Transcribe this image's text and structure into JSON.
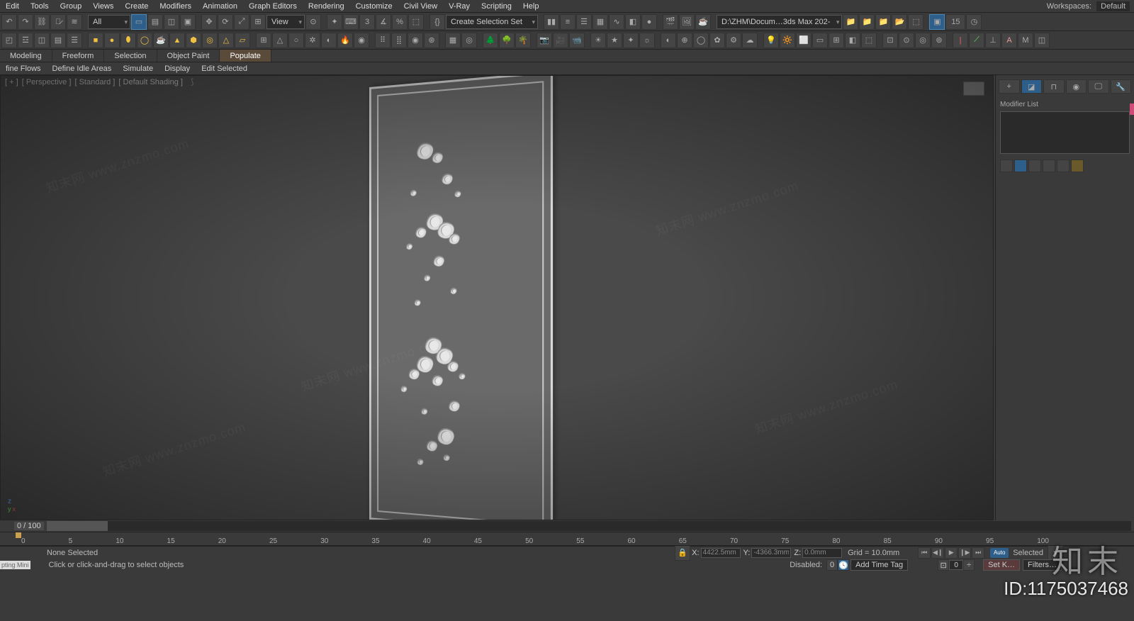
{
  "menu": {
    "items": [
      "Edit",
      "Tools",
      "Group",
      "Views",
      "Create",
      "Modifiers",
      "Animation",
      "Graph Editors",
      "Rendering",
      "Customize",
      "Civil View",
      "V-Ray",
      "Scripting",
      "Help"
    ],
    "workspaces_label": "Workspaces:",
    "workspaces_value": "Default"
  },
  "toolbar1": {
    "filter_dd": "All",
    "view_dd": "View",
    "selset_dd": "Create Selection Set",
    "path": "D:\\ZHM\\Docum…3ds Max 202-",
    "badge": "15"
  },
  "ribbon": {
    "tabs": [
      "Modeling",
      "Freeform",
      "Selection",
      "Object Paint",
      "Populate"
    ],
    "active": 4
  },
  "subribbon": {
    "items": [
      "fine Flows",
      "Define Idle Areas",
      "Simulate",
      "Display",
      "Edit Selected"
    ]
  },
  "viewport": {
    "labels": [
      "[ + ]",
      "[ Perspective ]",
      "[ Standard ]",
      "[ Default Shading ]"
    ],
    "filter_glyph": "⟆"
  },
  "cmdpanel": {
    "modifier_label": "Modifier List"
  },
  "timeline": {
    "frame_label": "0 / 100",
    "ticks": [
      "0",
      "5",
      "10",
      "15",
      "20",
      "25",
      "30",
      "35",
      "40",
      "45",
      "50",
      "55",
      "60",
      "65",
      "70",
      "75",
      "80",
      "85",
      "90",
      "95",
      "100"
    ]
  },
  "status": {
    "none_selected": "None Selected",
    "x_label": "X:",
    "x_val": "4422.5mm",
    "y_label": "Y:",
    "y_val": "-4366.3mm",
    "z_label": "Z:",
    "z_val": "0.0mm",
    "grid": "Grid = 10.0mm",
    "auto": "Auto",
    "selected": "Selected"
  },
  "status2": {
    "mini": "pting Mini",
    "hint": "Click or click-and-drag to select objects",
    "disabled": "Disabled:",
    "disabled_val": "0",
    "addtag": "Add Time Tag",
    "framebox": "0",
    "setk": "Set K…",
    "filters": "Filters…"
  },
  "id_overlay": "ID:1175037468",
  "logo_overlay": "知末",
  "watermark": "知末网 www.znzmo.com"
}
